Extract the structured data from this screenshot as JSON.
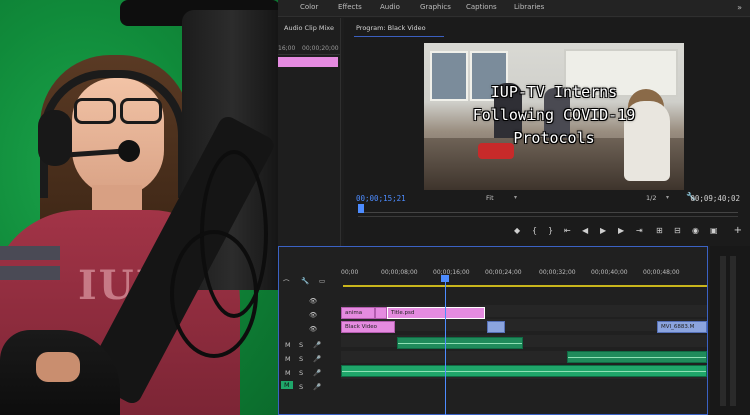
{
  "menu": {
    "items": [
      "Color",
      "Effects",
      "Audio",
      "Graphics",
      "Captions",
      "Libraries"
    ],
    "overflow": "»"
  },
  "audio_clip_mixer": {
    "title": "Audio Clip Mixe",
    "ruler": [
      "16;00",
      "00;00;20;00"
    ]
  },
  "program_monitor": {
    "title": "Program: Black Video",
    "overlay_lines": [
      "IUP-TV Interns",
      "Following COVID-19",
      "Protocols"
    ],
    "timecode_current": "00;00;15;21",
    "timecode_duration": "00;09;40;02",
    "zoom": "Fit",
    "resolution": "1/2",
    "add": "+"
  },
  "timeline": {
    "ruler": [
      "00;00",
      "00;00;08;00",
      "00;00;16;00",
      "00;00;24;00",
      "00;00;32;00",
      "00;00;40;00",
      "00;00;48;00"
    ],
    "track_letters": [
      "M",
      "M",
      "M",
      "M"
    ],
    "solo_letter": "S",
    "clips": {
      "anim": "anima",
      "title": "Title.psd",
      "black_video": "Black Video",
      "mvi": "MVI_6883.M"
    }
  }
}
